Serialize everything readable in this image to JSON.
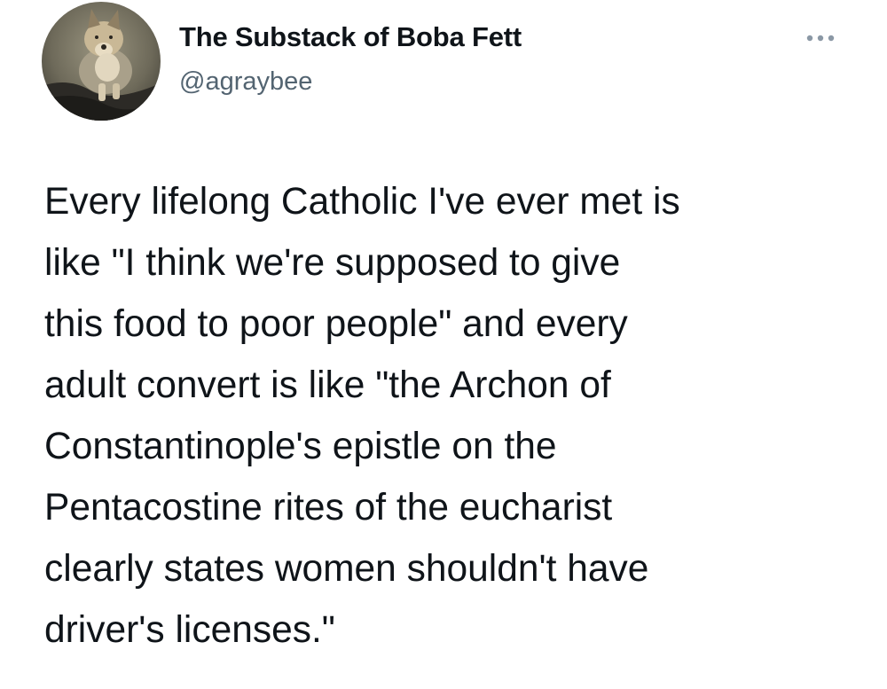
{
  "tweet": {
    "author": {
      "display_name": "The Substack of Boba Fett",
      "handle": "@agraybee",
      "avatar_icon": "fox-photo-avatar"
    },
    "more_icon": "more-dots-icon",
    "text_lines": [
      "Every lifelong Catholic I've ever met is",
      "like \"I think we're supposed to give",
      "this food to poor people\" and every",
      "adult convert is like \"the Archon of",
      "Constantinople's epistle on the",
      "Pentacostine rites of the eucharist",
      "clearly states women shouldn't have",
      "driver's licenses.\""
    ]
  },
  "colors": {
    "text_primary": "#0f1419",
    "text_secondary": "#536471",
    "background": "#ffffff"
  }
}
